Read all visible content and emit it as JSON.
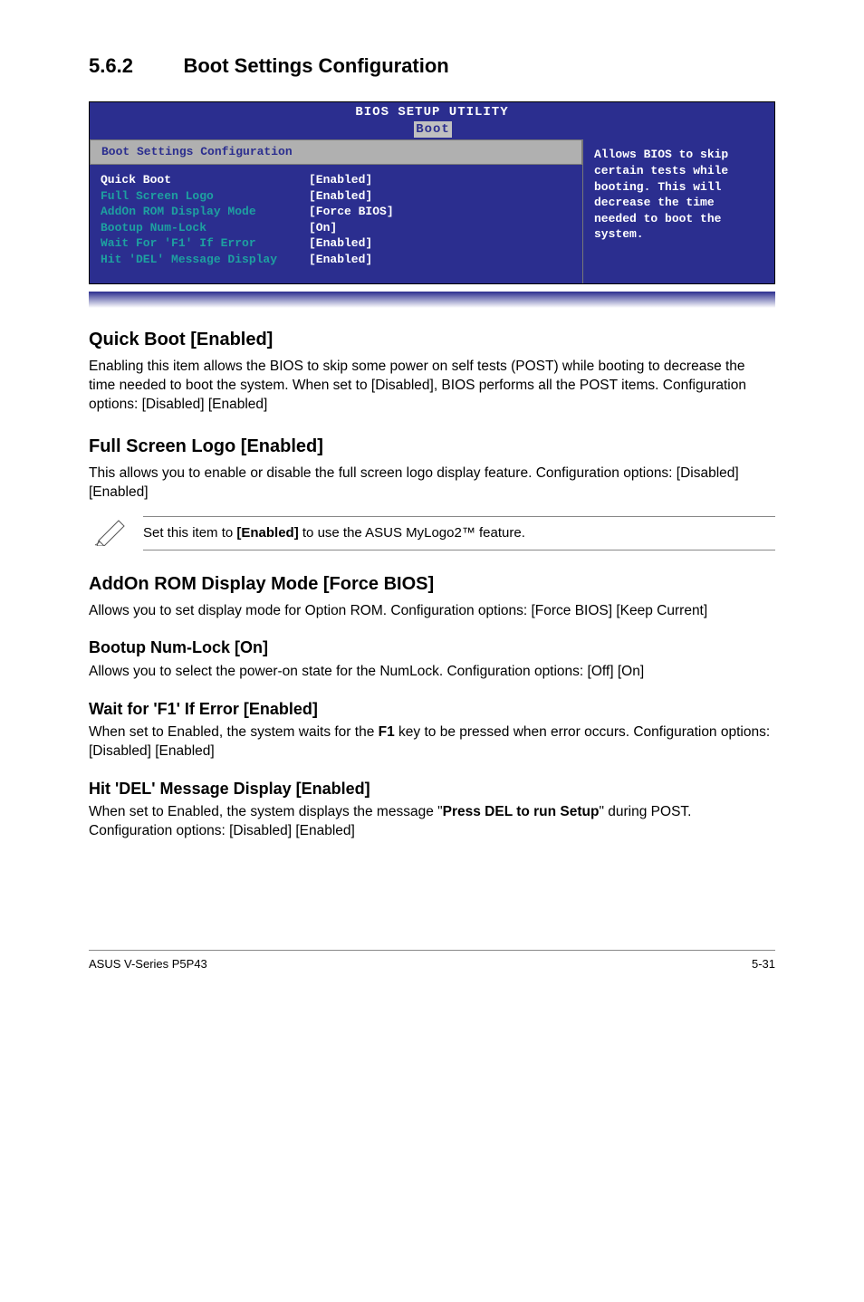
{
  "section": {
    "number": "5.6.2",
    "title": "Boot Settings Configuration"
  },
  "bios": {
    "header": "BIOS SETUP UTILITY",
    "tab": "Boot",
    "panel_title": "Boot Settings Configuration",
    "rows": [
      {
        "label": "Quick Boot",
        "value": "[Enabled]",
        "selected": true
      },
      {
        "label": "Full Screen Logo",
        "value": "[Enabled]"
      },
      {
        "label": "AddOn ROM Display Mode",
        "value": "[Force BIOS]"
      },
      {
        "label": "Bootup Num-Lock",
        "value": "[On]"
      },
      {
        "label": "Wait For 'F1' If Error",
        "value": "[Enabled]"
      },
      {
        "label": "Hit 'DEL' Message Display",
        "value": "[Enabled]"
      }
    ],
    "help": "Allows BIOS to skip certain tests while booting. This will decrease the time needed to boot the system."
  },
  "quick_boot": {
    "heading": "Quick Boot [Enabled]",
    "body": "Enabling this item allows the BIOS to skip some power on self tests (POST) while booting to decrease the time needed to boot the system. When set to [Disabled], BIOS performs all the POST items. Configuration options: [Disabled] [Enabled]"
  },
  "full_screen": {
    "heading": "Full Screen Logo [Enabled]",
    "body": "This allows you to enable or disable the full screen logo display feature. Configuration options: [Disabled] [Enabled]"
  },
  "note": {
    "pre": "Set this item to ",
    "bold": "[Enabled]",
    "post": " to use the ASUS MyLogo2™ feature."
  },
  "addon": {
    "heading": "AddOn ROM Display Mode [Force BIOS]",
    "body": "Allows you to set display mode for Option ROM. Configuration options: [Force BIOS] [Keep Current]"
  },
  "numlock": {
    "heading": "Bootup Num-Lock [On]",
    "body": "Allows you to select the power-on state for the NumLock. Configuration options: [Off] [On]"
  },
  "waitf1": {
    "heading": "Wait for 'F1' If Error [Enabled]",
    "pre": "When set to Enabled, the system waits for the ",
    "bold": "F1",
    "post": " key to be pressed when error occurs. Configuration options: [Disabled] [Enabled]"
  },
  "hitdel": {
    "heading": "Hit 'DEL' Message Display [Enabled]",
    "pre": "When set to Enabled, the system displays the message \"",
    "bold": "Press DEL to run Setup",
    "post": "\" during POST. Configuration options: [Disabled] [Enabled]"
  },
  "footer": {
    "left": "ASUS V-Series P5P43",
    "right": "5-31"
  }
}
